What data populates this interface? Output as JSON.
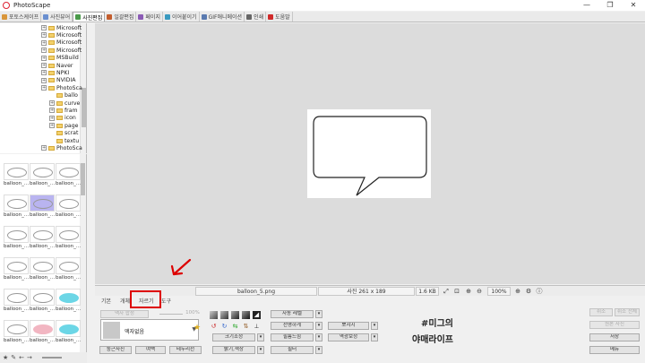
{
  "window": {
    "title": "PhotoScape",
    "controls": [
      "—",
      "❐",
      "✕"
    ]
  },
  "tabs": [
    {
      "label": "포토스케이프",
      "color": "#d9963a"
    },
    {
      "label": "사진뷰어",
      "color": "#6a8fd0"
    },
    {
      "label": "사진편집",
      "color": "#4a9a4a",
      "active": true
    },
    {
      "label": "일괄편집",
      "color": "#c35d2d"
    },
    {
      "label": "페이지",
      "color": "#8b5bb5"
    },
    {
      "label": "이어붙이기",
      "color": "#3a9ac0"
    },
    {
      "label": "GIF애니메이션",
      "color": "#5a7ab0"
    },
    {
      "label": "인쇄",
      "color": "#666666"
    },
    {
      "label": "도움말",
      "color": "#d02a2a"
    }
  ],
  "tree": {
    "items": [
      {
        "label": "Microsoft",
        "expandable": true
      },
      {
        "label": "Microsoft",
        "expandable": true
      },
      {
        "label": "Microsoft",
        "expandable": true
      },
      {
        "label": "Microsoft",
        "expandable": true
      },
      {
        "label": "MSBuild",
        "expandable": true
      },
      {
        "label": "Naver",
        "expandable": true
      },
      {
        "label": "NPKI",
        "expandable": true
      },
      {
        "label": "NVIDIA",
        "expandable": true
      },
      {
        "label": "PhotoSca",
        "expandable": true
      },
      {
        "label": "ballo",
        "expandable": false,
        "child": true
      },
      {
        "label": "curve",
        "expandable": true,
        "child": true
      },
      {
        "label": "fram",
        "expandable": true,
        "child": true
      },
      {
        "label": "icon",
        "expandable": true,
        "child": true
      },
      {
        "label": "page",
        "expandable": true,
        "child": true
      },
      {
        "label": "scrat",
        "expandable": false,
        "child": true
      },
      {
        "label": "textu",
        "expandable": false,
        "child": true
      },
      {
        "label": "PhotoSca",
        "expandable": true
      }
    ]
  },
  "thumbnails": {
    "label": "balloon_...",
    "items": [
      {
        "style": "plain"
      },
      {
        "style": "plain"
      },
      {
        "style": "plain"
      },
      {
        "style": "plain"
      },
      {
        "style": "selected"
      },
      {
        "style": "plain"
      },
      {
        "style": "plain"
      },
      {
        "style": "plain"
      },
      {
        "style": "plain"
      },
      {
        "style": "plain"
      },
      {
        "style": "plain"
      },
      {
        "style": "plain"
      },
      {
        "style": "plain"
      },
      {
        "style": "plain"
      },
      {
        "style": "cyan"
      },
      {
        "style": "plain"
      },
      {
        "style": "pink"
      },
      {
        "style": "cyan"
      }
    ]
  },
  "statusbar": {
    "filename": "balloon_5.png",
    "size": "사진 261 x 189",
    "filesize": "1.6 KB",
    "zoom": "100%"
  },
  "bottom_panel": {
    "tabs": [
      "기본",
      "개체",
      "자르기",
      "도구"
    ],
    "photo_size_button": "액자 합성",
    "zoom_value": "100%",
    "frame_name": "액자없음",
    "buttons_row": [
      "둥근사진",
      "여백",
      "테두리선"
    ],
    "col2": [
      "자동 레벨",
      "선명하게",
      "필름느낌",
      "필터"
    ],
    "col2_left": [
      "크기조정",
      "밝기,색상"
    ],
    "col3": [
      "뽀샤시",
      "역광보정"
    ],
    "right_buttons": [
      "취소",
      "취소 전체",
      "원본 사진",
      "저장",
      "메뉴"
    ]
  },
  "annotation": {
    "line1": "#미그의",
    "line2": "야매라이프",
    "highlight_color": "#dd0000"
  }
}
